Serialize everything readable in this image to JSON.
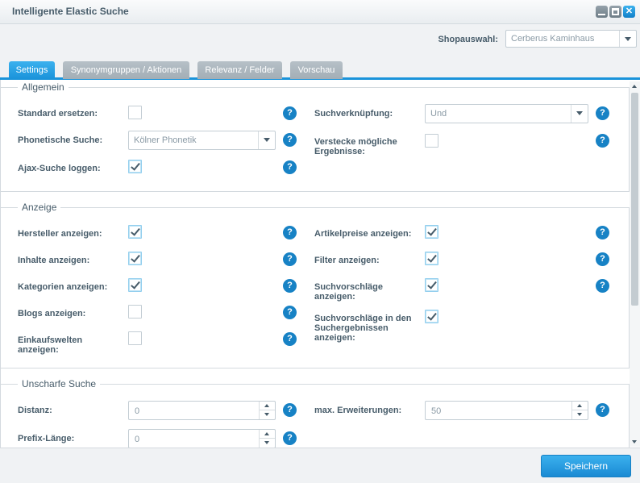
{
  "window": {
    "title": "Intelligente Elastic Suche",
    "buttons": {
      "minimize_icon": "minimize-icon",
      "maximize_icon": "maximize-icon",
      "close_icon": "close-icon",
      "close_glyph": "✕"
    }
  },
  "shop": {
    "label": "Shopauswahl:",
    "value": "Cerberus Kaminhaus"
  },
  "tabs": [
    {
      "label": "Settings",
      "active": true
    },
    {
      "label": "Synonymgruppen / Aktionen",
      "active": false
    },
    {
      "label": "Relevanz / Felder",
      "active": false
    },
    {
      "label": "Vorschau",
      "active": false
    }
  ],
  "help_glyph": "?",
  "sections": {
    "allgemein": {
      "title": "Allgemein",
      "standard_ersetzen": {
        "label": "Standard ersetzen:",
        "checked": false
      },
      "phonetische_suche": {
        "label": "Phonetische Suche:",
        "value": "Kölner Phonetik"
      },
      "ajax_suche": {
        "label": "Ajax-Suche loggen:",
        "checked": true
      },
      "suchverknuepfung": {
        "label": "Suchverknüpfung:",
        "value": "Und"
      },
      "verstecke": {
        "label_line1": "Verstecke mögliche",
        "label_line2": "Ergebnisse:",
        "checked": false
      }
    },
    "anzeige": {
      "title": "Anzeige",
      "hersteller": {
        "label": "Hersteller anzeigen:",
        "checked": true
      },
      "inhalte": {
        "label": "Inhalte anzeigen:",
        "checked": true
      },
      "kategorien": {
        "label": "Kategorien anzeigen:",
        "checked": true
      },
      "blogs": {
        "label": "Blogs anzeigen:",
        "checked": false
      },
      "einkaufswelten": {
        "label_line1": "Einkaufswelten",
        "label_line2": "anzeigen:",
        "checked": false
      },
      "artikelpreise": {
        "label": "Artikelpreise anzeigen:",
        "checked": true
      },
      "filter": {
        "label": "Filter anzeigen:",
        "checked": true
      },
      "suchvorschlaege": {
        "label_line1": "Suchvorschläge",
        "label_line2": "anzeigen:",
        "checked": true
      },
      "suchvorschlaege_ergebnisse": {
        "label_line1": "Suchvorschläge in den",
        "label_line2": "Suchergebnissen",
        "label_line3": "anzeigen:",
        "checked": true
      }
    },
    "unscharfe": {
      "title": "Unscharfe Suche",
      "distanz": {
        "label": "Distanz:",
        "value": "0"
      },
      "prefix": {
        "label": "Prefix-Länge:",
        "value": "0"
      },
      "max_erweiterungen": {
        "label": "max. Erweiterungen:",
        "value": "50"
      }
    }
  },
  "footer": {
    "save_label": "Speichern"
  }
}
